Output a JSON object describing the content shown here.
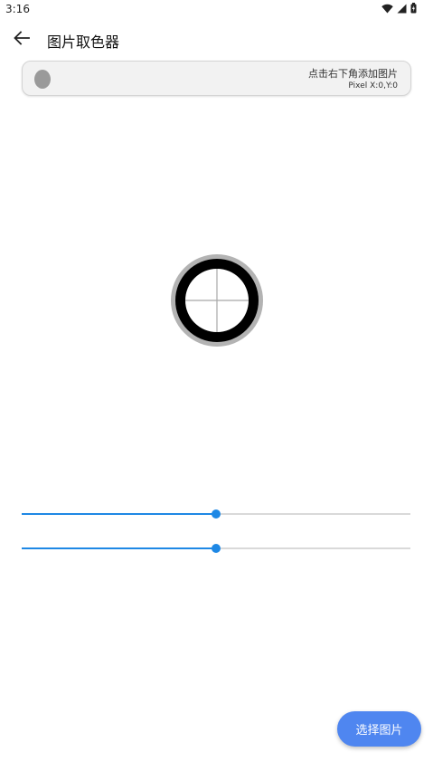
{
  "status_bar": {
    "time": "3:16",
    "icons": [
      "wifi-icon",
      "cell-signal-icon",
      "battery-icon"
    ]
  },
  "app_bar": {
    "title": "图片取色器",
    "back_icon": "arrow-left-icon"
  },
  "info_card": {
    "swatch_color": "#9a9a9a",
    "hint": "点击右下角添加图片",
    "pixel_label": "Pixel",
    "pixel_x": "X:0",
    "pixel_y": "Y:0"
  },
  "sliders": [
    {
      "name": "slider-horizontal",
      "value": 0.5
    },
    {
      "name": "slider-vertical",
      "value": 0.5
    }
  ],
  "fab": {
    "label": "选择图片"
  },
  "colors": {
    "accent": "#1e88e5",
    "fab": "#4f86f0"
  }
}
